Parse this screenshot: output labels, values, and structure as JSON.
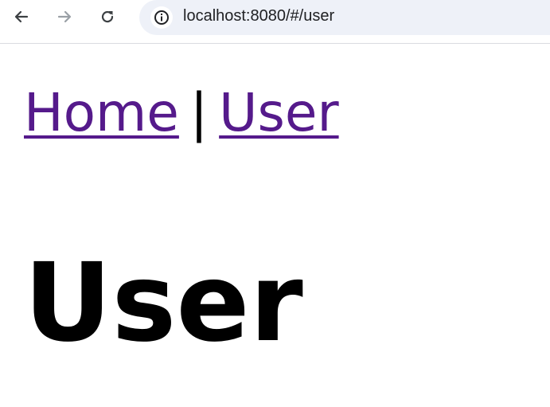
{
  "browser": {
    "url": "localhost:8080/#/user",
    "icons": {
      "back": "arrow-left-icon",
      "forward": "arrow-right-icon",
      "reload": "reload-icon",
      "info": "info-icon"
    }
  },
  "page": {
    "nav": {
      "home_label": "Home",
      "separator": "|",
      "user_label": "User"
    },
    "heading": "User"
  },
  "colors": {
    "link_visited": "#551a8b",
    "omnibox_bg": "#eef1f8",
    "text": "#000000"
  }
}
